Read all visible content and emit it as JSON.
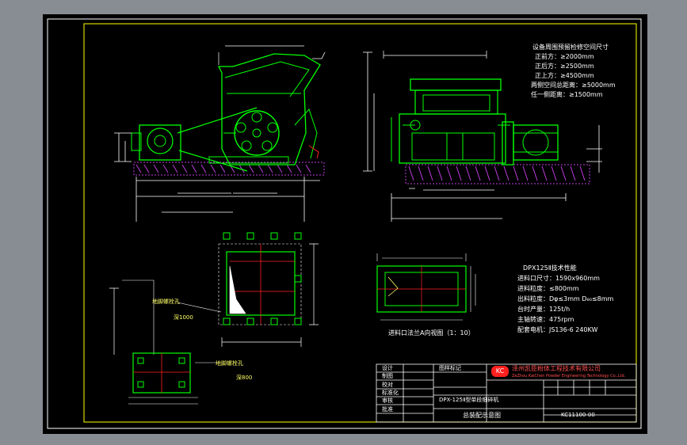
{
  "space_requirements": {
    "title": "设备周围预留检修空间尺寸",
    "lines": [
      "正前方：≥2000mm",
      "正后方：≥2500mm",
      "正上方：≥4500mm",
      "两侧空间总距离：≥5000mm",
      "任一侧距离：≥1500mm"
    ]
  },
  "tech_params": {
    "title": "DPX125Ⅱ技术性能",
    "lines": [
      "进料口尺寸：1590x960mm",
      "进料粒度：≤800mm",
      "出料粒度：Dφ≤3mm D₈₀≤8mm",
      "台时产量：125t/h",
      "主轴转速：475rpm",
      "配套电机：JS136-6 240KW"
    ]
  },
  "labels": {
    "feed_view": "进料口法兰A向视图（1：10）",
    "anchor_hole_1": "地脚螺栓孔",
    "anchor_hole_2": "地脚螺栓孔",
    "depth_1": "深1000",
    "depth_2": "深800"
  },
  "title_block": {
    "company": "泽州凯臣粉体工程技术有限公司",
    "company_en": "ZeZhou KaiChen Powder Engineering Technology Co.,Ltd.",
    "logo": "KC",
    "drawing_name_label": "图样标记",
    "product": "DPX-125Ⅱ型单段细碎机",
    "drawing_title": "总装配示意图",
    "drawing_no": "KC11100-00",
    "roles": [
      "设计",
      "制图",
      "校对",
      "标准化",
      "审核",
      "批准"
    ]
  },
  "colors": {
    "background": "#000000",
    "frame": "#ffff00",
    "machine": "#00ff00",
    "dimension": "#ffffff",
    "hatch": "#c03ce0",
    "accent": "#ff2020"
  }
}
